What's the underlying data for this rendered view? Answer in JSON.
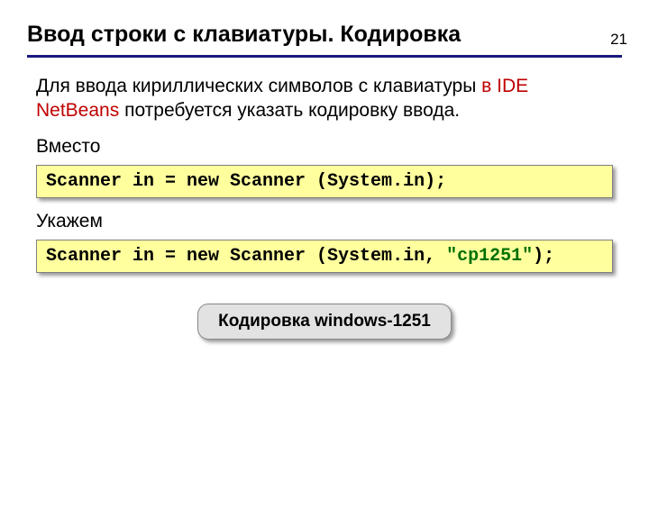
{
  "pageNumber": "21",
  "title": "Ввод строки с клавиатуры. Кодировка",
  "intro": {
    "part1": "Для ввода кириллических символов с клавиатуры ",
    "hl": "в IDE NetBeans",
    "part2": " потребуется указать кодировку ввода."
  },
  "label1": "Вместо",
  "code1": "Scanner in = new Scanner (System.in);",
  "label2": "Укажем",
  "code2": {
    "pre": "Scanner in = new Scanner (System.in, ",
    "cp": "\"cp1251\"",
    "post": ");"
  },
  "badge": "Кодировка windows-1251"
}
